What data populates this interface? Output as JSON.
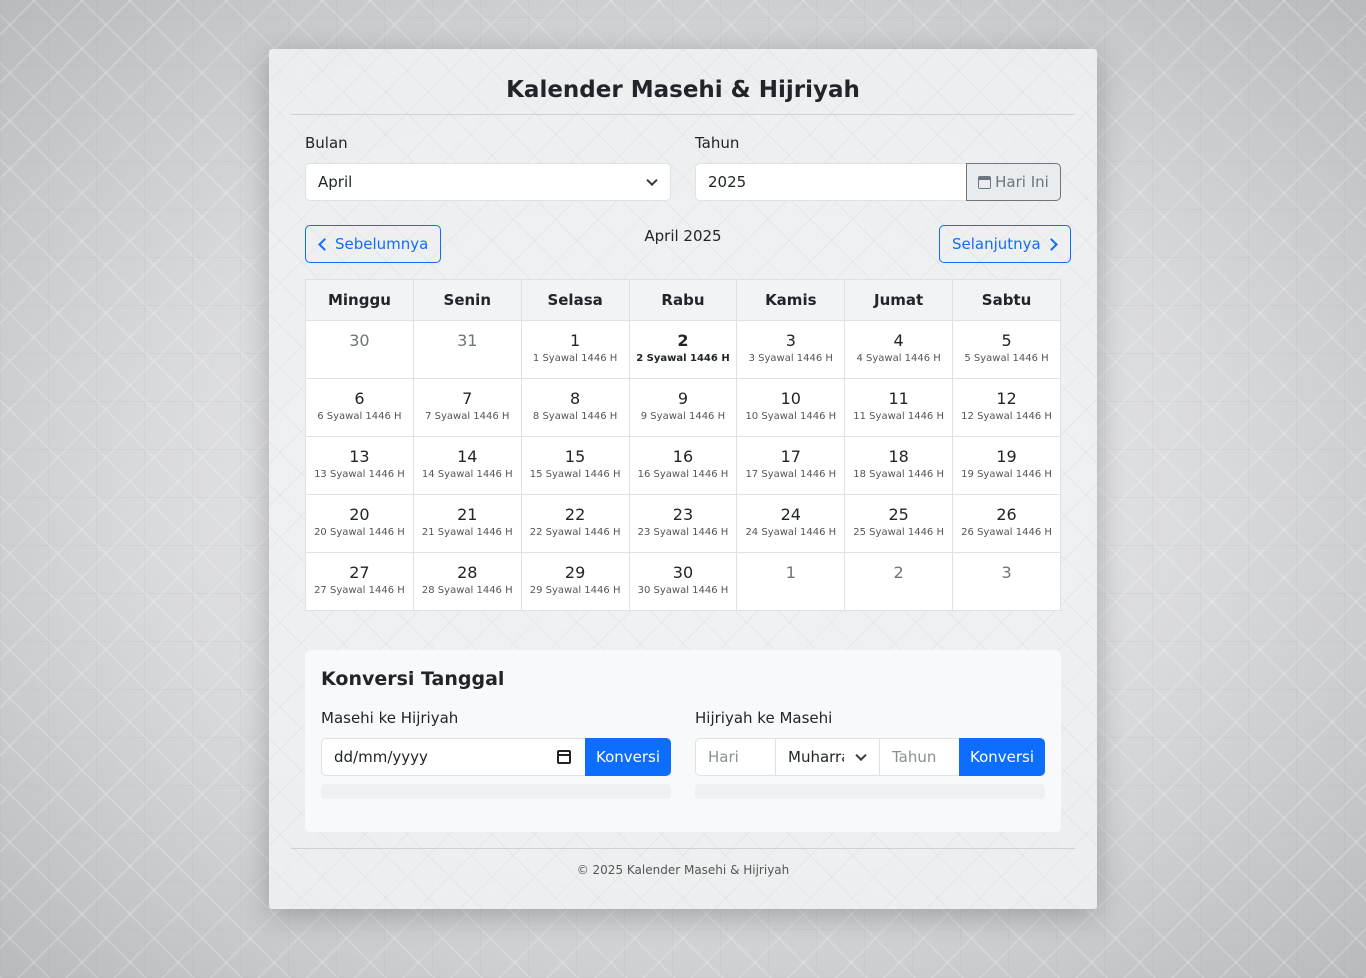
{
  "app": {
    "title": "Kalender Masehi & Hijriyah"
  },
  "controls": {
    "month_label": "Bulan",
    "month_value": "April",
    "year_label": "Tahun",
    "year_value": "2025",
    "today_button": "Hari Ini"
  },
  "nav": {
    "prev": "Sebelumnya",
    "current": "April 2025",
    "next": "Selanjutnya"
  },
  "calendar": {
    "weekdays": [
      "Minggu",
      "Senin",
      "Selasa",
      "Rabu",
      "Kamis",
      "Jumat",
      "Sabtu"
    ],
    "weeks": [
      [
        {
          "g": "30",
          "h": "",
          "other": true
        },
        {
          "g": "31",
          "h": "",
          "other": true
        },
        {
          "g": "1",
          "h": "1 Syawal 1446 H"
        },
        {
          "g": "2",
          "h": "2 Syawal 1446 H",
          "today": true
        },
        {
          "g": "3",
          "h": "3 Syawal 1446 H"
        },
        {
          "g": "4",
          "h": "4 Syawal 1446 H"
        },
        {
          "g": "5",
          "h": "5 Syawal 1446 H"
        }
      ],
      [
        {
          "g": "6",
          "h": "6 Syawal 1446 H"
        },
        {
          "g": "7",
          "h": "7 Syawal 1446 H"
        },
        {
          "g": "8",
          "h": "8 Syawal 1446 H"
        },
        {
          "g": "9",
          "h": "9 Syawal 1446 H"
        },
        {
          "g": "10",
          "h": "10 Syawal 1446 H"
        },
        {
          "g": "11",
          "h": "11 Syawal 1446 H"
        },
        {
          "g": "12",
          "h": "12 Syawal 1446 H"
        }
      ],
      [
        {
          "g": "13",
          "h": "13 Syawal 1446 H"
        },
        {
          "g": "14",
          "h": "14 Syawal 1446 H"
        },
        {
          "g": "15",
          "h": "15 Syawal 1446 H"
        },
        {
          "g": "16",
          "h": "16 Syawal 1446 H"
        },
        {
          "g": "17",
          "h": "17 Syawal 1446 H"
        },
        {
          "g": "18",
          "h": "18 Syawal 1446 H"
        },
        {
          "g": "19",
          "h": "19 Syawal 1446 H"
        }
      ],
      [
        {
          "g": "20",
          "h": "20 Syawal 1446 H"
        },
        {
          "g": "21",
          "h": "21 Syawal 1446 H"
        },
        {
          "g": "22",
          "h": "22 Syawal 1446 H"
        },
        {
          "g": "23",
          "h": "23 Syawal 1446 H"
        },
        {
          "g": "24",
          "h": "24 Syawal 1446 H"
        },
        {
          "g": "25",
          "h": "25 Syawal 1446 H"
        },
        {
          "g": "26",
          "h": "26 Syawal 1446 H"
        }
      ],
      [
        {
          "g": "27",
          "h": "27 Syawal 1446 H"
        },
        {
          "g": "28",
          "h": "28 Syawal 1446 H"
        },
        {
          "g": "29",
          "h": "29 Syawal 1446 H"
        },
        {
          "g": "30",
          "h": "30 Syawal 1446 H"
        },
        {
          "g": "1",
          "h": "",
          "other": true
        },
        {
          "g": "2",
          "h": "",
          "other": true
        },
        {
          "g": "3",
          "h": "",
          "other": true
        }
      ]
    ]
  },
  "conversion": {
    "title": "Konversi Tanggal",
    "m2h_label": "Masehi ke Hijriyah",
    "m2h_placeholder": "dd/mm/yyyy",
    "m2h_button": "Konversi",
    "h2m_label": "Hijriyah ke Masehi",
    "h2m_day_placeholder": "Hari",
    "h2m_month_value": "Muharram",
    "h2m_year_placeholder": "Tahun",
    "h2m_button": "Konversi"
  },
  "footer": {
    "text": "© 2025 Kalender Masehi & Hijriyah"
  },
  "colors": {
    "primary": "#0d6efd",
    "secondary": "#6c757d"
  }
}
